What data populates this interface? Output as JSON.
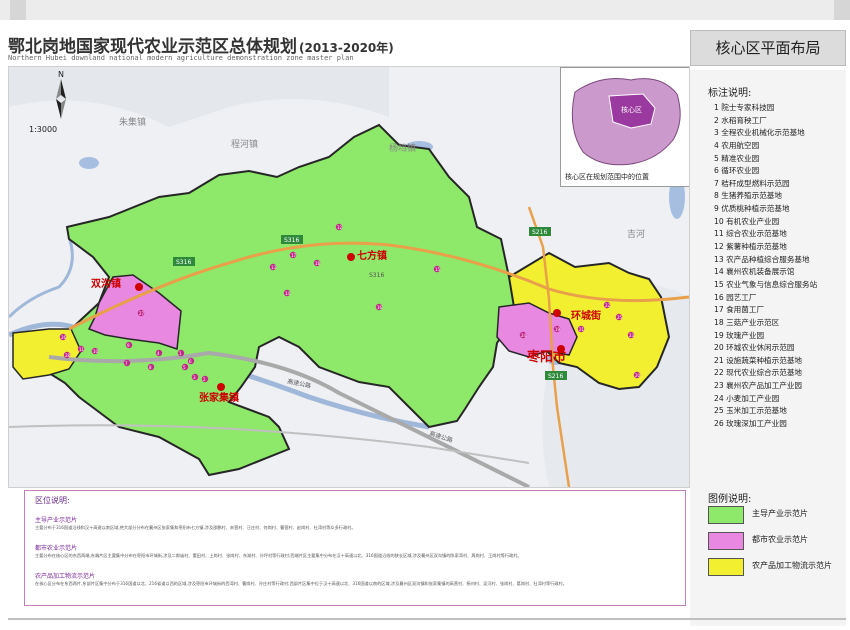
{
  "header": {
    "title": "鄂北岗地国家现代农业示范区总体规划",
    "title_years": "(2013-2020年)",
    "subtitle": "Northern Hubei downland national modern agriculture demonstration zone master plan",
    "panel_title": "核心区平面布局"
  },
  "map": {
    "scale": "1:3000",
    "compass": "N",
    "inset_label": "核心区",
    "inset_caption": "核心区在规划范围中的位置",
    "place_labels": {
      "shuanggou": "双沟镇",
      "qifang": "七方镇",
      "zhangjiaji": "张家集镇",
      "huancheng": "环城街",
      "zaoyang": "枣阳市",
      "zhuji": "朱集镇",
      "chenghe": "程河镇",
      "yangdang": "杨垱镇",
      "jiqiao": "吉河"
    },
    "road_labels": {
      "s316_a": "S316",
      "s316_b": "S316",
      "s316_c": "S316",
      "s216": "S216",
      "s216_b": "S216",
      "expressway_a": "高速公路",
      "expressway_b": "高速公路"
    },
    "point_numbers": [
      "1",
      "2",
      "3",
      "4",
      "5",
      "6",
      "7",
      "8",
      "9",
      "10",
      "11",
      "12",
      "13",
      "14",
      "15",
      "16",
      "17",
      "18",
      "19",
      "20",
      "21",
      "22",
      "23",
      "24",
      "25",
      "26",
      "27",
      "28"
    ]
  },
  "legend": {
    "heading": "标注说明:",
    "items": [
      "1  院士专家科技园",
      "2  水稻育秧工厂",
      "3  全程农业机械化示范基地",
      "4  农用航空园",
      "5  精准农业园",
      "6  循环农业园",
      "7  秸秆成型燃料示范园",
      "8  生猪养殖示范基地",
      "9  优质桃种植示范基地",
      "10  有机农业产业园",
      "11  综合农业示范基地",
      "12  紫薯种植示范基地",
      "13  农产品种植综合服务基地",
      "14  襄州农机装备展示馆",
      "15  农业气象与信息综合服务站",
      "16  园艺工厂",
      "17  食用菌工厂",
      "18  三菇产业示范区",
      "19  玫瑰产业园",
      "20  环城农业休闲示范园",
      "21  设施蔬菜种植示范基地",
      "22  现代农业综合示范基地",
      "23  襄州农产品加工产业园",
      "24  小麦加工产业园",
      "25  玉米加工示范基地",
      "26  玫瑰深加工产业园"
    ]
  },
  "figure_legend": {
    "heading": "图例说明:",
    "items": [
      {
        "label": "主导产业示范片",
        "color": "#8ee86a"
      },
      {
        "label": "都市农业示范片",
        "color": "#e888e0"
      },
      {
        "label": "农产品加工物流示范片",
        "color": "#f2ee30"
      }
    ]
  },
  "zone_description": {
    "heading": "区位说明:",
    "sections": [
      {
        "title": "主导产业示范片",
        "text": "主要分布于316国道沿线和汉十高速以南区域,绝大部分分布在襄州区张家集和枣阳市七方镇,涉及邵鹏村、宋营村、汪庄村、何岗村、曹营村、赵岗村、杜湾村等众多行政村。"
      },
      {
        "title": "都市农业示范片",
        "text": "主要分布在核心区的东西两端,东端片区主要集中分布在枣阳市环城街,涉及二郎庙村、董田村、上岗村、张岗村、东湖村、孙坪村等行政村;西端片区主要集中分布在汉十高速以北、316国道沿线的狭长区域,涉及襄州区双沟镇的陈家湾村、周岗村、王岗村等行政村。"
      },
      {
        "title": "农产品加工物流示范片",
        "text": "在核心区分布在东西两片,东部片区集中分布于316国道以北、216省道以西的区域,涉及枣阳市环城街的西湾村、曹岗村、孙庄村等行政村;西部片区集中位于汉十高速以北、316国道以南的区域,涉及襄州区双沟镇和张家集镇的高营村、杨刘村、吴河村、张岗村、葛岗村、杜湾村等行政村。"
      }
    ]
  }
}
